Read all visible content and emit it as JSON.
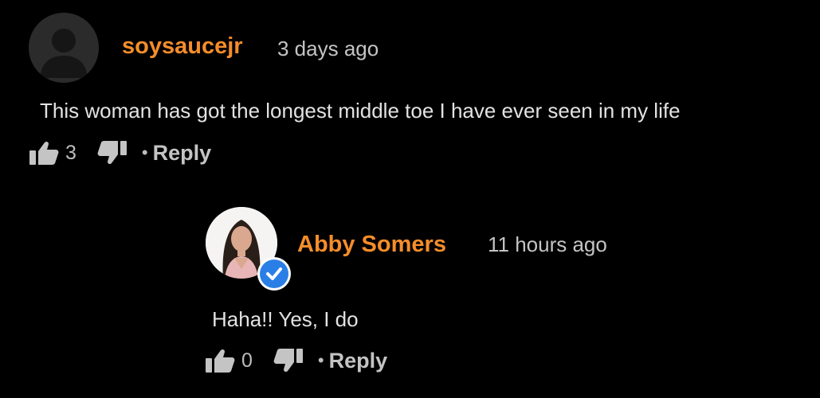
{
  "accent_color": "#f58d2a",
  "verified_color": "#2a7fe6",
  "comments": [
    {
      "username": "soysaucejr",
      "timestamp": "3 days ago",
      "text": "This woman has got the longest middle toe I have ever seen in my life",
      "likes": "3",
      "bullet": "•",
      "reply_label": "Reply",
      "avatar_icon": "default-user-icon"
    },
    {
      "username": "Abby Somers",
      "timestamp": "11 hours ago",
      "text": "Haha!! Yes, I do",
      "likes": "0",
      "bullet": "•",
      "reply_label": "Reply",
      "avatar_icon": "profile-photo",
      "verified": true
    }
  ]
}
